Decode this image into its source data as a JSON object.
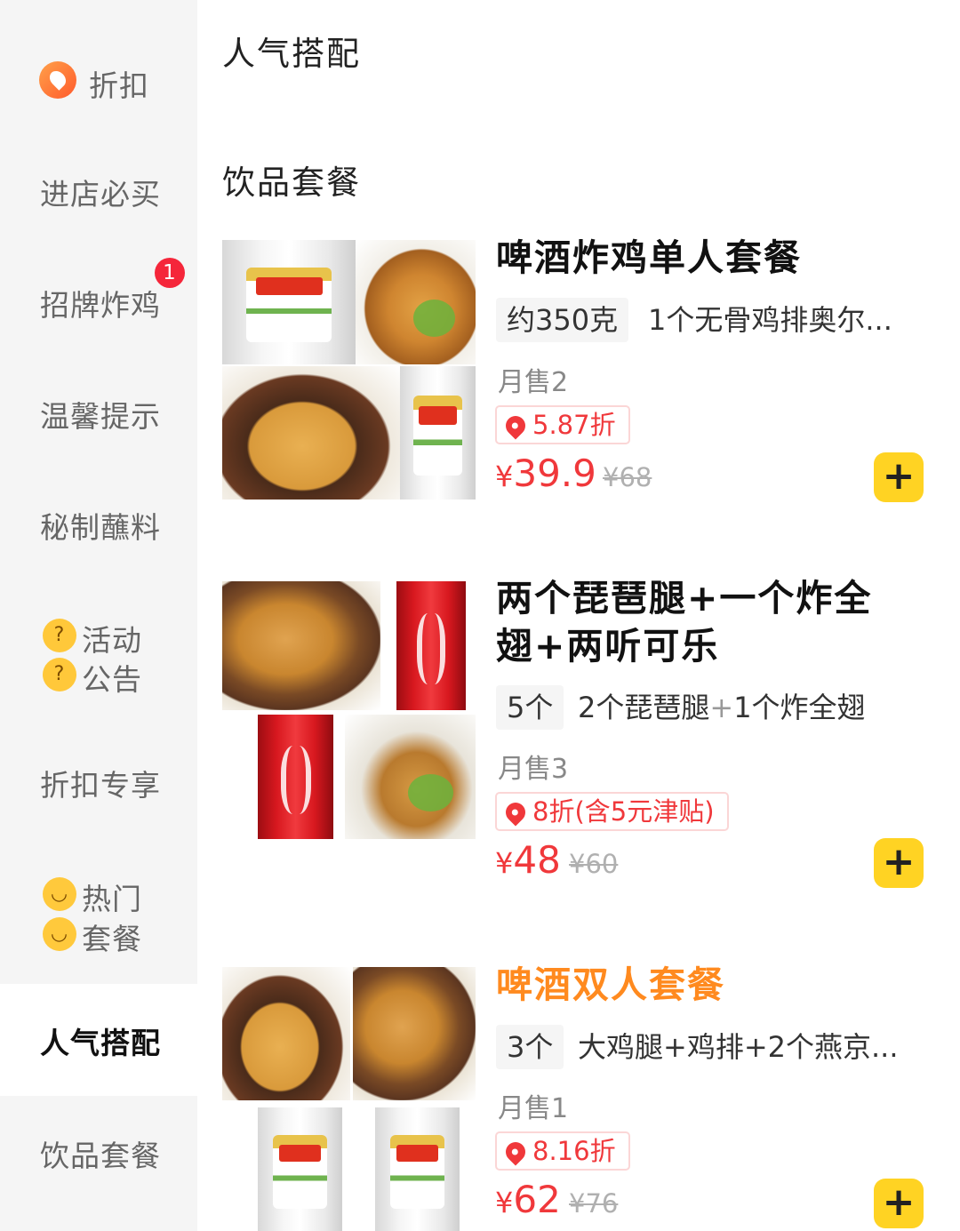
{
  "sidebar": {
    "items": [
      {
        "label": "折扣",
        "icon": "discount-pin-icon"
      },
      {
        "label": "进店必买"
      },
      {
        "label": "招牌炸鸡",
        "badge": "1"
      },
      {
        "label": "温馨提示"
      },
      {
        "label": "秘制蘸料"
      },
      {
        "label_line1": "活动",
        "label_line2": "公告",
        "icon": "thinking-face-icon"
      },
      {
        "label": "折扣专享"
      },
      {
        "label_line1": "热门",
        "label_line2": "套餐",
        "icon": "smiling-face-icon"
      },
      {
        "label": "人气搭配",
        "active": true
      },
      {
        "label": "饮品套餐"
      }
    ]
  },
  "sections": {
    "popular_title": "人气搭配",
    "drinks_title": "饮品套餐"
  },
  "products": [
    {
      "title": "啤酒炸鸡单人套餐",
      "spec": "约350克",
      "desc": "1个无骨鸡排奥尔...",
      "sales": "月售2",
      "discount": "5.87折",
      "currency": "¥",
      "price": "39.9",
      "original_price": "¥68",
      "add": "+"
    },
    {
      "title_line1": "两个琵琶腿+一个炸全",
      "title_line2": "翅+两听可乐",
      "spec": "5个",
      "desc_part1": "2个琵琶腿",
      "desc_plus": "+",
      "desc_part2": "1个炸全翅",
      "sales": "月售3",
      "discount": "8折(含5元津贴)",
      "currency": "¥",
      "price": "48",
      "original_price": "¥60",
      "add": "+"
    },
    {
      "title": "啤酒双人套餐",
      "title_color": "#ff8a1f",
      "spec": "3个",
      "desc": "大鸡腿+鸡排+2个燕京...",
      "sales": "月售1",
      "discount": "8.16折",
      "currency": "¥",
      "price": "62",
      "original_price": "¥76",
      "add": "+"
    }
  ],
  "colors": {
    "accent_red": "#f0383b",
    "add_button": "#ffd323",
    "sidebar_bg": "#f5f5f5",
    "highlight_title": "#ff8a1f"
  }
}
